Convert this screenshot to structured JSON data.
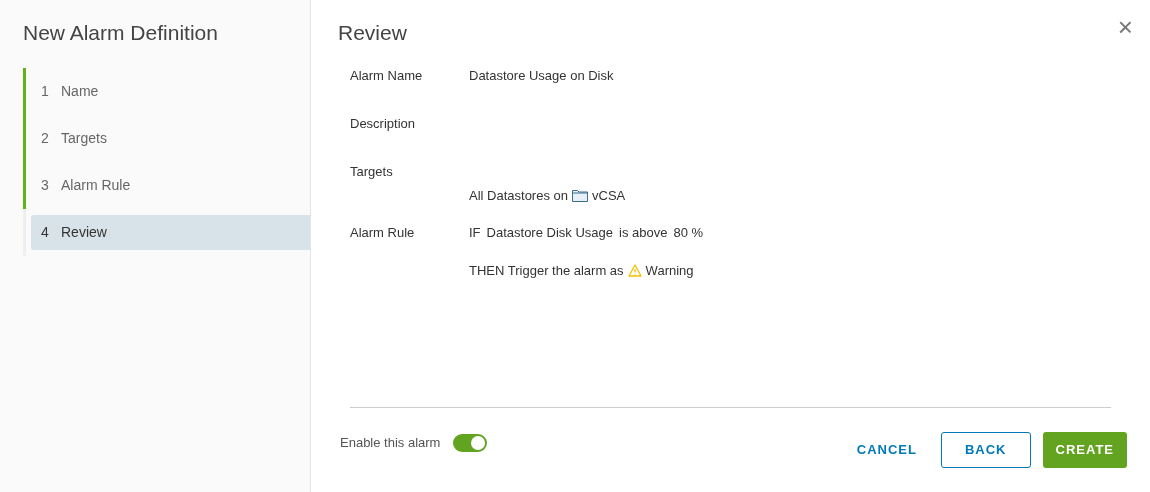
{
  "wizard": {
    "title": "New Alarm Definition",
    "steps": [
      {
        "number": "1",
        "label": "Name",
        "completed": true,
        "selected": false
      },
      {
        "number": "2",
        "label": "Targets",
        "completed": true,
        "selected": false
      },
      {
        "number": "3",
        "label": "Alarm Rule",
        "completed": true,
        "selected": false
      },
      {
        "number": "4",
        "label": "Review",
        "completed": false,
        "selected": true
      }
    ]
  },
  "page": {
    "title": "Review",
    "close": "×",
    "rows": [
      {
        "kind": "text",
        "label": "Alarm Name",
        "value": "Datastore Usage on Disk"
      },
      {
        "kind": "text",
        "label": "Description"
      },
      {
        "kind": "target",
        "label": "Targets",
        "prefix": "All Datastores on",
        "value": "vCSA"
      },
      {
        "kind": "rule",
        "label": "Alarm Rule",
        "condition": [
          "IF",
          "Datastore Disk Usage",
          "is above",
          "80 %"
        ],
        "action": "THEN Trigger the alarm as",
        "severity": "Warning"
      }
    ]
  },
  "footer": {
    "toggle": {
      "label": "Enable this alarm",
      "on": true
    },
    "buttons": [
      {
        "kind": "link",
        "label": "CANCEL"
      },
      {
        "kind": "outline",
        "label": "BACK"
      },
      {
        "kind": "primary",
        "label": "CREATE"
      }
    ]
  }
}
